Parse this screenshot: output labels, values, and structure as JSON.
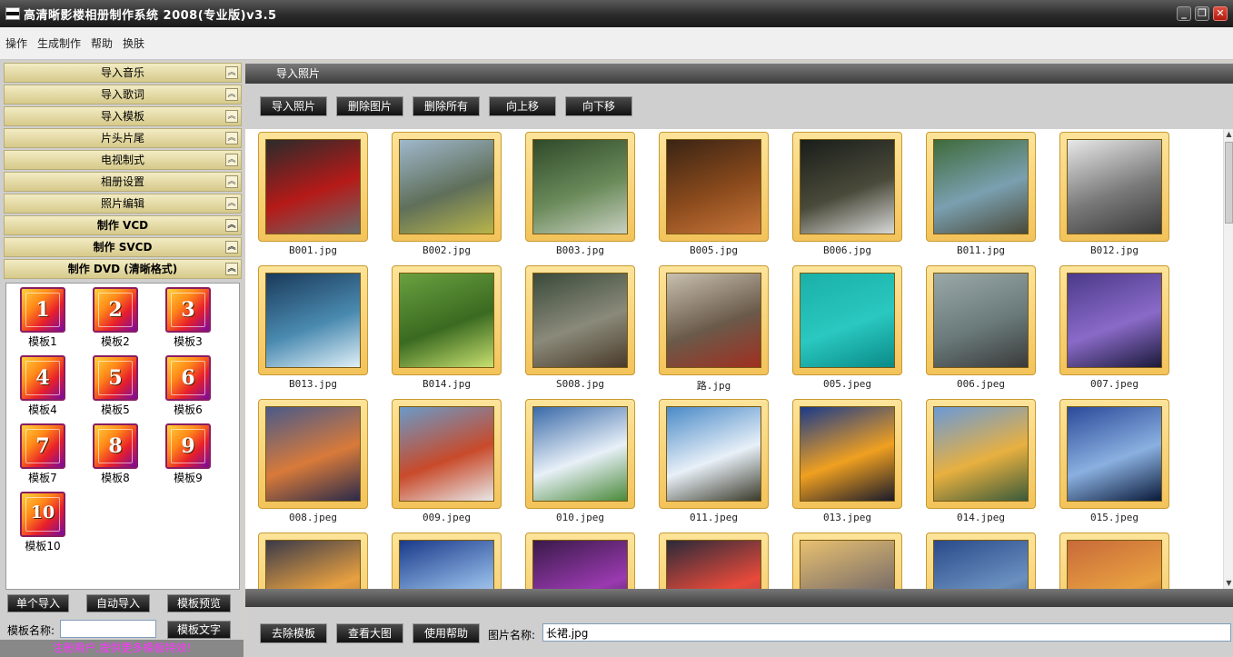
{
  "window": {
    "title": "高清晰影楼相册制作系统  2008(专业版)v3.5",
    "buttons": [
      "_",
      "❐",
      "✕"
    ]
  },
  "menu": [
    "操作",
    "生成制作",
    "帮助",
    "换肤"
  ],
  "accordion": [
    {
      "label": "导入音乐"
    },
    {
      "label": "导入歌词"
    },
    {
      "label": "导入模板"
    },
    {
      "label": "片头片尾"
    },
    {
      "label": "电视制式"
    },
    {
      "label": "相册设置"
    },
    {
      "label": "照片编辑"
    },
    {
      "label": "制作 VCD"
    },
    {
      "label": "制作 SVCD"
    },
    {
      "label": "制作 DVD (清晰格式)"
    }
  ],
  "templates": [
    {
      "num": "1",
      "label": "模板1"
    },
    {
      "num": "2",
      "label": "模板2"
    },
    {
      "num": "3",
      "label": "模板3"
    },
    {
      "num": "4",
      "label": "模板4"
    },
    {
      "num": "5",
      "label": "模板5"
    },
    {
      "num": "6",
      "label": "模板6"
    },
    {
      "num": "7",
      "label": "模板7"
    },
    {
      "num": "8",
      "label": "模板8"
    },
    {
      "num": "9",
      "label": "模板9"
    },
    {
      "num": "10",
      "label": "模板10"
    }
  ],
  "left_buttons": {
    "single_import": "单个导入",
    "auto_import": "自动导入",
    "preview": "模板预览",
    "text": "模板文字"
  },
  "template_name": {
    "label": "模板名称:",
    "value": ""
  },
  "register_notice": "注册用户,提供更多模板特效!",
  "section_title": "导入照片",
  "photo_buttons": {
    "import": "导入照片",
    "delete": "删除图片",
    "delete_all": "删除所有",
    "move_up": "向上移",
    "move_down": "向下移"
  },
  "photos": [
    {
      "name": "B001.jpg",
      "colors": [
        "#2b2b2b",
        "#b51a18",
        "#6a6a6a"
      ]
    },
    {
      "name": "B002.jpg",
      "colors": [
        "#9fb8cc",
        "#5f6f5a",
        "#b8b54a"
      ]
    },
    {
      "name": "B003.jpg",
      "colors": [
        "#2f4a2a",
        "#6a8a5a",
        "#c8d0c0"
      ]
    },
    {
      "name": "B005.jpg",
      "colors": [
        "#3a2414",
        "#8a4a1c",
        "#c8763a"
      ]
    },
    {
      "name": "B006.jpg",
      "colors": [
        "#1a1e1a",
        "#4a4a3a",
        "#d8d8d8"
      ]
    },
    {
      "name": "B011.jpg",
      "colors": [
        "#3f6a3a",
        "#7aa0b0",
        "#4a4a3a"
      ]
    },
    {
      "name": "B012.jpg",
      "colors": [
        "#e8e8e8",
        "#7a7a7a",
        "#3a3a3a"
      ]
    },
    {
      "name": "B013.jpg",
      "colors": [
        "#1a3a5a",
        "#4a8ab0",
        "#e0f0f8"
      ]
    },
    {
      "name": "B014.jpg",
      "colors": [
        "#6aa040",
        "#3a6a20",
        "#c8e070"
      ]
    },
    {
      "name": "S008.jpg",
      "colors": [
        "#3a4a3a",
        "#8a8a7a",
        "#4a3a2a"
      ]
    },
    {
      "name": "路.jpg",
      "colors": [
        "#c8c0b0",
        "#6a5a4a",
        "#a03020"
      ]
    },
    {
      "name": "005.jpeg",
      "colors": [
        "#1ab0a8",
        "#2ac8c0",
        "#0a8a88"
      ]
    },
    {
      "name": "006.jpeg",
      "colors": [
        "#9aa8a8",
        "#6a7a7a",
        "#3a3a3a"
      ]
    },
    {
      "name": "007.jpeg",
      "colors": [
        "#4a3a8a",
        "#8a6ac8",
        "#1a1a3a"
      ]
    },
    {
      "name": "008.jpeg",
      "colors": [
        "#4a5a8a",
        "#d87a3a",
        "#2a2a4a"
      ]
    },
    {
      "name": "009.jpeg",
      "colors": [
        "#6a9ac8",
        "#c84a2a",
        "#e8e8e8"
      ]
    },
    {
      "name": "010.jpeg",
      "colors": [
        "#3a6aa8",
        "#e8f0f8",
        "#4a8a3a"
      ]
    },
    {
      "name": "011.jpeg",
      "colors": [
        "#4a8ac8",
        "#e8f0f8",
        "#3a3a2a"
      ]
    },
    {
      "name": "013.jpeg",
      "colors": [
        "#1a3a8a",
        "#f0a020",
        "#1a1a2a"
      ]
    },
    {
      "name": "014.jpeg",
      "colors": [
        "#6a9ad8",
        "#e8b040",
        "#3a5a3a"
      ]
    },
    {
      "name": "015.jpeg",
      "colors": [
        "#2a4a9a",
        "#8ab0e0",
        "#0a1a3a"
      ]
    },
    {
      "name": "",
      "colors": [
        "#3a3a4a",
        "#e8a040",
        "#8a6a3a"
      ]
    },
    {
      "name": "",
      "colors": [
        "#1a3a8a",
        "#8ab0e0",
        "#f0f0ff"
      ]
    },
    {
      "name": "",
      "colors": [
        "#3a1a4a",
        "#9a3ab0",
        "#1a0a2a"
      ]
    },
    {
      "name": "",
      "colors": [
        "#2a2a3a",
        "#e84a3a",
        "#6a3a5a"
      ]
    },
    {
      "name": "",
      "colors": [
        "#e8c070",
        "#8a7a6a",
        "#3a3a4a"
      ]
    },
    {
      "name": "",
      "colors": [
        "#2a4a8a",
        "#6a90c0",
        "#1a3a5a"
      ]
    },
    {
      "name": "",
      "colors": [
        "#c86a3a",
        "#e8a040",
        "#8a4a2a"
      ]
    }
  ],
  "bottom_buttons": {
    "remove_template": "去除模板",
    "view_large": "查看大图",
    "help": "使用帮助"
  },
  "image_name": {
    "label": "图片名称:",
    "value": "长裙.jpg"
  }
}
